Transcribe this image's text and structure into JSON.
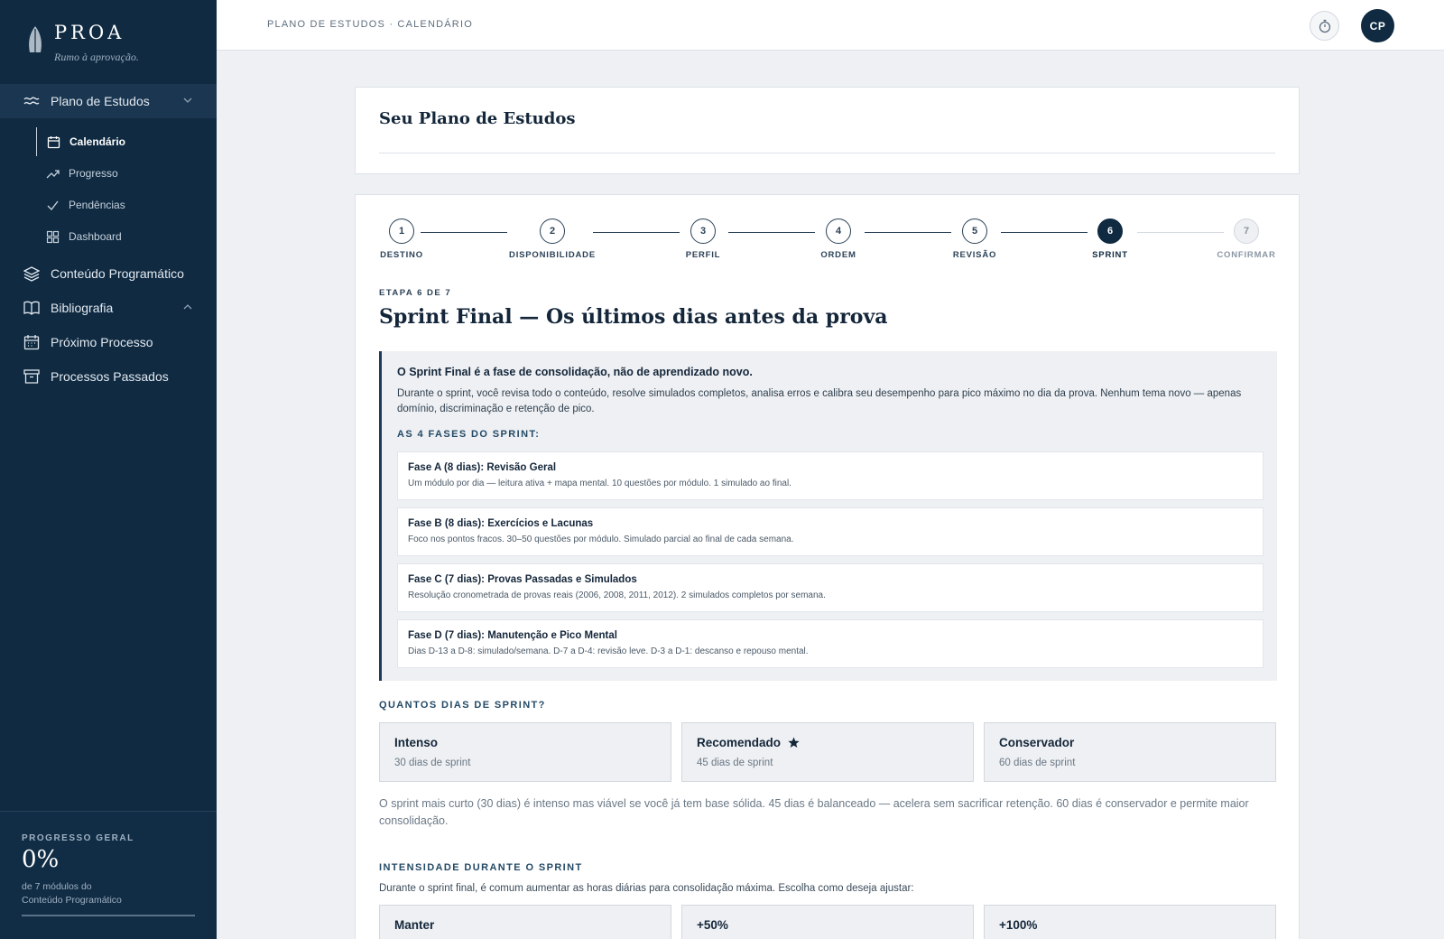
{
  "brand": {
    "name": "PROA",
    "tagline": "Rumo à aprovação."
  },
  "sidebar": {
    "main_items": [
      {
        "label": "Plano de Estudos",
        "icon": "waves-icon",
        "active": true,
        "expanded": true
      },
      {
        "label": "Conteúdo Programático",
        "icon": "layers-icon"
      },
      {
        "label": "Bibliografia",
        "icon": "book-icon",
        "expanded": true
      },
      {
        "label": "Próximo Processo",
        "icon": "calendar-icon"
      },
      {
        "label": "Processos Passados",
        "icon": "archive-icon"
      }
    ],
    "sub_items": [
      {
        "label": "Calendário",
        "icon": "calendar-icon",
        "active": true
      },
      {
        "label": "Progresso",
        "icon": "trend-up-icon"
      },
      {
        "label": "Pendências",
        "icon": "check-icon"
      },
      {
        "label": "Dashboard",
        "icon": "grid-icon"
      }
    ],
    "progress": {
      "label": "PROGRESSO GERAL",
      "value": "0%",
      "fraction": 0,
      "line1": "de 7 módulos do",
      "line2": "Conteúdo Programático"
    }
  },
  "header": {
    "breadcrumb": "PLANO DE ESTUDOS · CALENDÁRIO",
    "avatar_initials": "CP"
  },
  "page": {
    "title": "Seu Plano de Estudos"
  },
  "stepper": {
    "current": 6,
    "steps": [
      {
        "number": "1",
        "label": "DESTINO"
      },
      {
        "number": "2",
        "label": "DISPONIBILIDADE"
      },
      {
        "number": "3",
        "label": "PERFIL"
      },
      {
        "number": "4",
        "label": "ORDEM"
      },
      {
        "number": "5",
        "label": "REVISÃO"
      },
      {
        "number": "6",
        "label": "SPRINT"
      },
      {
        "number": "7",
        "label": "CONFIRMAR"
      }
    ]
  },
  "step": {
    "kicker": "ETAPA 6 DE 7",
    "title": "Sprint Final — Os últimos dias antes da prova"
  },
  "info": {
    "lead": "O Sprint Final é a fase de consolidação, não de aprendizado novo.",
    "body": "Durante o sprint, você revisa todo o conteúdo, resolve simulados completos, analisa erros e calibra seu desempenho para pico máximo no dia da prova. Nenhum tema novo — apenas domínio, discriminação e retenção de pico.",
    "phases_title": "AS 4 FASES DO SPRINT:",
    "phases": [
      {
        "title": "Fase A (8 dias): Revisão Geral",
        "desc": "Um módulo por dia — leitura ativa + mapa mental. 10 questões por módulo. 1 simulado ao final."
      },
      {
        "title": "Fase B (8 dias): Exercícios e Lacunas",
        "desc": "Foco nos pontos fracos. 30–50 questões por módulo. Simulado parcial ao final de cada semana."
      },
      {
        "title": "Fase C (7 dias): Provas Passadas e Simulados",
        "desc": "Resolução cronometrada de provas reais (2006, 2008, 2011, 2012). 2 simulados completos por semana."
      },
      {
        "title": "Fase D (7 dias): Manutenção e Pico Mental",
        "desc": "Dias D-13 a D-8: simulado/semana. D-7 a D-4: revisão leve. D-3 a D-1: descanso e repouso mental."
      }
    ]
  },
  "sprint_days": {
    "label": "QUANTOS DIAS DE SPRINT?",
    "options": [
      {
        "title": "Intenso",
        "sub": "30 dias de sprint"
      },
      {
        "title": "Recomendado",
        "sub": "45 dias de sprint",
        "icon": "star-icon"
      },
      {
        "title": "Conservador",
        "sub": "60 dias de sprint"
      }
    ],
    "explain": "O sprint mais curto (30 dias) é intenso mas viável se você já tem base sólida. 45 dias é balanceado — acelera sem sacrificar retenção. 60 dias é conservador e permite maior consolidação."
  },
  "intensity": {
    "label": "INTENSIDADE DURANTE O SPRINT",
    "desc": "Durante o sprint final, é comum aumentar as horas diárias para consolidação máxima. Escolha como deseja ajustar:",
    "options": [
      {
        "title": "Manter"
      },
      {
        "title": "+50%"
      },
      {
        "title": "+100%"
      }
    ]
  }
}
